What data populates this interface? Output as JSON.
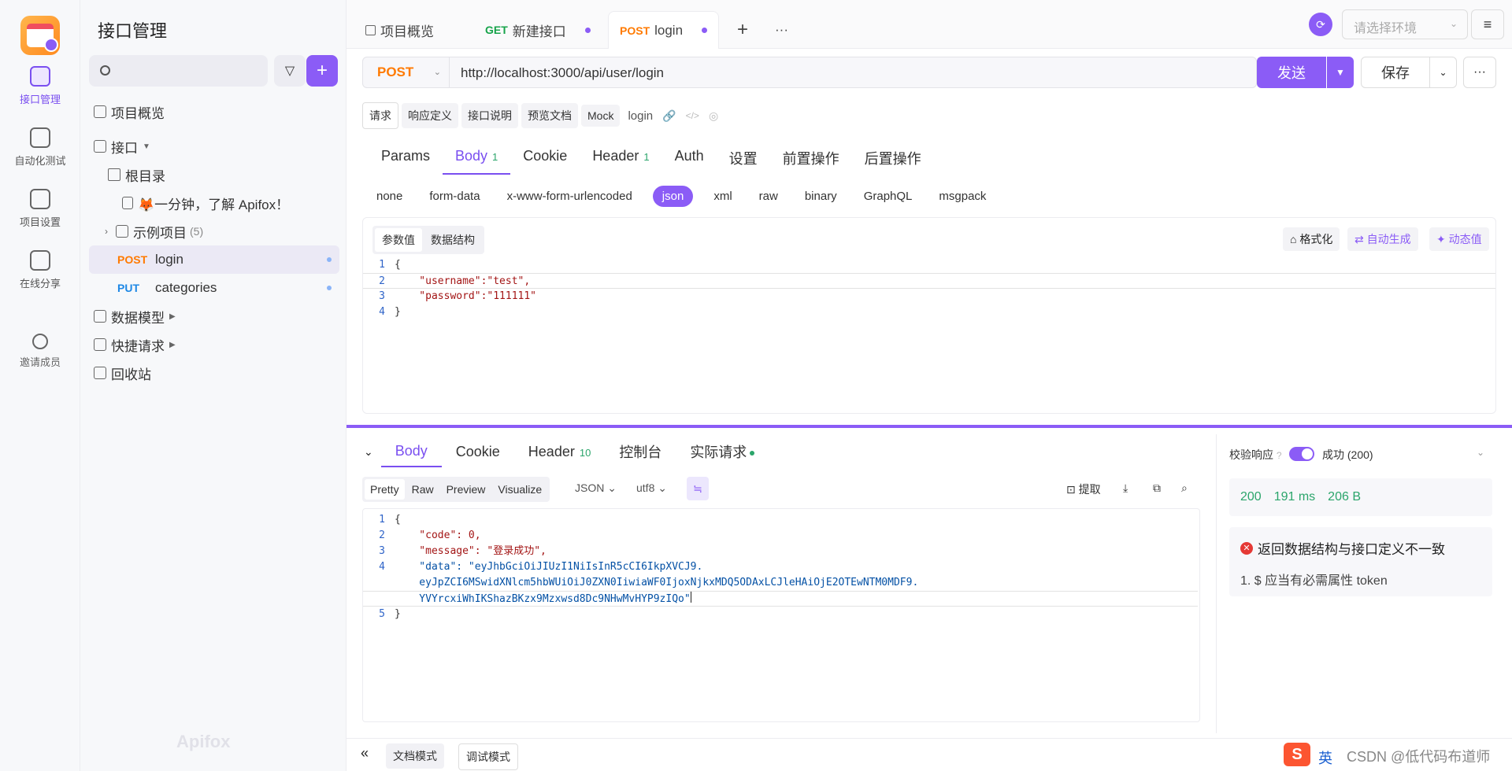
{
  "rail": {
    "items": [
      {
        "label": "接口管理",
        "icon": "api-icon",
        "active": true
      },
      {
        "label": "自动化测试",
        "icon": "test-icon",
        "active": false
      },
      {
        "label": "项目设置",
        "icon": "settings-icon",
        "active": false
      },
      {
        "label": "在线分享",
        "icon": "share-icon",
        "active": false
      },
      {
        "label": "邀请成员",
        "icon": "user-add-icon",
        "active": false
      }
    ]
  },
  "sidebar": {
    "title": "接口管理",
    "overview": "项目概览",
    "interfaces": "接口",
    "root": "根目录",
    "doc_item": "🦊一分钟，了解 Apifox！",
    "example_folder": "示例项目",
    "example_count": "(5)",
    "endpoints": [
      {
        "method": "POST",
        "name": "login"
      },
      {
        "method": "PUT",
        "name": "categories"
      }
    ],
    "data_model": "数据模型",
    "quick_request": "快捷请求",
    "recycle": "回收站",
    "brand": "Apifox"
  },
  "tabs": {
    "overview": "项目概览",
    "new_method": "GET",
    "new_label": "新建接口",
    "login_method": "POST",
    "login_label": "login",
    "add": "+",
    "more": "···"
  },
  "env": {
    "placeholder": "请选择环境"
  },
  "request": {
    "method": "POST",
    "url": "http://localhost:3000/api/user/login",
    "send": "发送",
    "save": "保存"
  },
  "subtabs": [
    "请求",
    "响应定义",
    "接口说明",
    "预览文档",
    "Mock"
  ],
  "subtab_name": "login",
  "reqtabs": [
    {
      "label": "Params",
      "badge": ""
    },
    {
      "label": "Body",
      "badge": "1"
    },
    {
      "label": "Cookie",
      "badge": ""
    },
    {
      "label": "Header",
      "badge": "1"
    },
    {
      "label": "Auth",
      "badge": ""
    },
    {
      "label": "设置",
      "badge": ""
    },
    {
      "label": "前置操作",
      "badge": ""
    },
    {
      "label": "后置操作",
      "badge": ""
    }
  ],
  "body_types": [
    "none",
    "form-data",
    "x-www-form-urlencoded",
    "json",
    "xml",
    "raw",
    "binary",
    "GraphQL",
    "msgpack"
  ],
  "editor": {
    "tab_params": "参数值",
    "tab_schema": "数据结构",
    "format": "格式化",
    "auto_gen": "自动生成",
    "dynamic": "动态值",
    "lines": [
      "{",
      "    \"username\":\"test\",",
      "    \"password\":\"111111\"",
      "}"
    ]
  },
  "response": {
    "tabs": [
      {
        "label": "Body",
        "badge": ""
      },
      {
        "label": "Cookie",
        "badge": ""
      },
      {
        "label": "Header",
        "badge": "10"
      },
      {
        "label": "控制台",
        "badge": ""
      },
      {
        "label": "实际请求",
        "badge": ""
      }
    ],
    "formats": [
      "Pretty",
      "Raw",
      "Preview",
      "Visualize"
    ],
    "type": "JSON",
    "encoding": "utf8",
    "extract": "提取",
    "lines": [
      "{",
      "    \"code\": 0,",
      "    \"message\": \"登录成功\",",
      "    \"data\": \"eyJhbGciOiJIUzI1NiIsInR5cCI6IkpXVCJ9.",
      "    eyJpZCI6MSwidXNlcm5hbWUiOiJ0ZXN0IiwiaWF0IjoxNjkxMDQ5ODAxLCJleHAiOjE2OTEwNTM0MDF9.",
      "    YVYrcxiWhIKShazBKzx9Mzxwsd8Dc9NHwMvHYP9zIQo\"",
      "}"
    ],
    "line_numbers": [
      "1",
      "2",
      "3",
      "4",
      "",
      "",
      "5"
    ]
  },
  "validation": {
    "label": "校验响应",
    "status_label": "成功 (200)",
    "status": "200",
    "time": "191 ms",
    "size": "206 B",
    "error_title": "返回数据结构与接口定义不一致",
    "error_item": "1. $ 应当有必需属性 token"
  },
  "bottom": {
    "doc_mode": "文档模式",
    "debug_mode": "调试模式"
  },
  "watermark": {
    "csdn_logo": "S",
    "ime": "英",
    "text": "CSDN @低代码布道师"
  }
}
